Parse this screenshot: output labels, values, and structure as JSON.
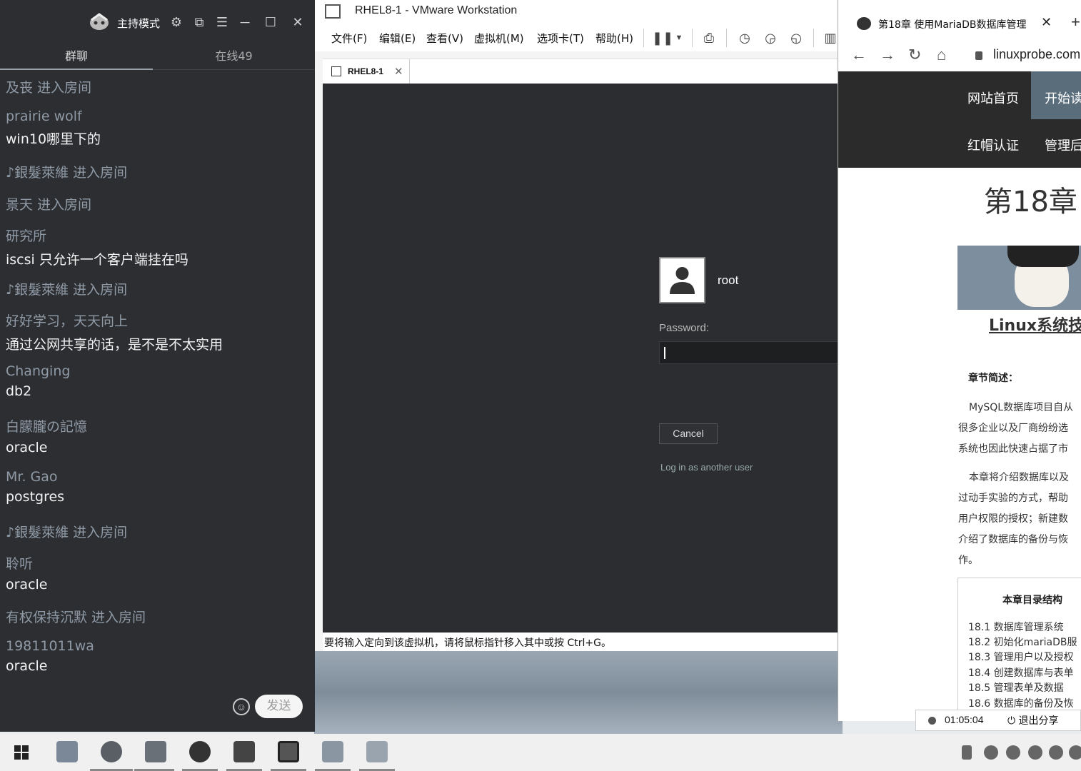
{
  "chat": {
    "mode_label": "主持模式",
    "tabs": [
      "群聊",
      "在线49"
    ],
    "messages": [
      {
        "type": "join",
        "text": "及丧 进入房间"
      },
      {
        "type": "msg",
        "name": "prairie wolf",
        "text": "win10哪里下的"
      },
      {
        "type": "join",
        "text": "♪銀髮萊維 进入房间"
      },
      {
        "type": "join",
        "text": "景天 进入房间"
      },
      {
        "type": "msg",
        "name": "研究所",
        "text": "iscsi 只允许一个客户端挂在吗"
      },
      {
        "type": "join",
        "text": "♪銀髮萊維 进入房间"
      },
      {
        "type": "msg",
        "name": "好好学习，天天向上",
        "text": "通过公网共享的话，是不是不太实用"
      },
      {
        "type": "msg",
        "name": "Changing",
        "text": "db2"
      },
      {
        "type": "msg",
        "name": "白朦朧の記憶",
        "text": "oracle"
      },
      {
        "type": "msg",
        "name": "Mr. Gao",
        "text": "postgres"
      },
      {
        "type": "join",
        "text": "♪銀髮萊維 进入房间"
      },
      {
        "type": "msg",
        "name": "聆听",
        "text": "oracle"
      },
      {
        "type": "join",
        "text": "有权保持沉默 进入房间"
      },
      {
        "type": "msg",
        "name": "19811011wa",
        "text": "oracle"
      }
    ],
    "send_label": "发送",
    "emoji_icon": "☺"
  },
  "vmware": {
    "title": "RHEL8-1 - VMware Workstation",
    "menus": [
      "文件(F)",
      "编辑(E)",
      "查看(V)",
      "虚拟机(M)",
      "选项卡(T)",
      "帮助(H)"
    ],
    "tab_label": "RHEL8-1",
    "login": {
      "username": "root",
      "password_label": "Password:",
      "cancel_label": "Cancel",
      "other_user_label": "Log in as another user"
    },
    "status_text": "要将输入定向到该虚拟机，请将鼠标指针移入其中或按 Ctrl+G。"
  },
  "browser": {
    "tab_title": "第18章 使用MariaDB数据库管理",
    "url": "linuxprobe.com",
    "nav": [
      "网站首页",
      "开始读",
      "红帽认证",
      "管理后"
    ],
    "heading": "第18章",
    "book_title": "Linux系统技",
    "summary_label": "章节简述：",
    "paragraphs": [
      [
        "MySQL数据库项目自从",
        "很多企业以及厂商纷纷选",
        "系统也因此快速占据了市"
      ],
      [
        "本章将介绍数据库以及",
        "过动手实验的方式，帮助",
        "用户权限的授权；新建数",
        "介绍了数据库的备份与恢",
        "作。"
      ]
    ],
    "toc_title": "本章目录结构",
    "toc": [
      "18.1 数据库管理系统",
      "18.2 初始化mariaDB服",
      "18.3 管理用户以及授权",
      "18.4 创建数据库与表单",
      "18.5 管理表单及数据",
      "18.6 数据库的备份及恢"
    ]
  },
  "share": {
    "time": "01:05:04",
    "exit_label": "退出分享"
  },
  "colors": {
    "chat_bg": "#2c2e31",
    "vm_screen_bg": "#2b2d30",
    "site_nav_bg": "#2b2b2b"
  }
}
